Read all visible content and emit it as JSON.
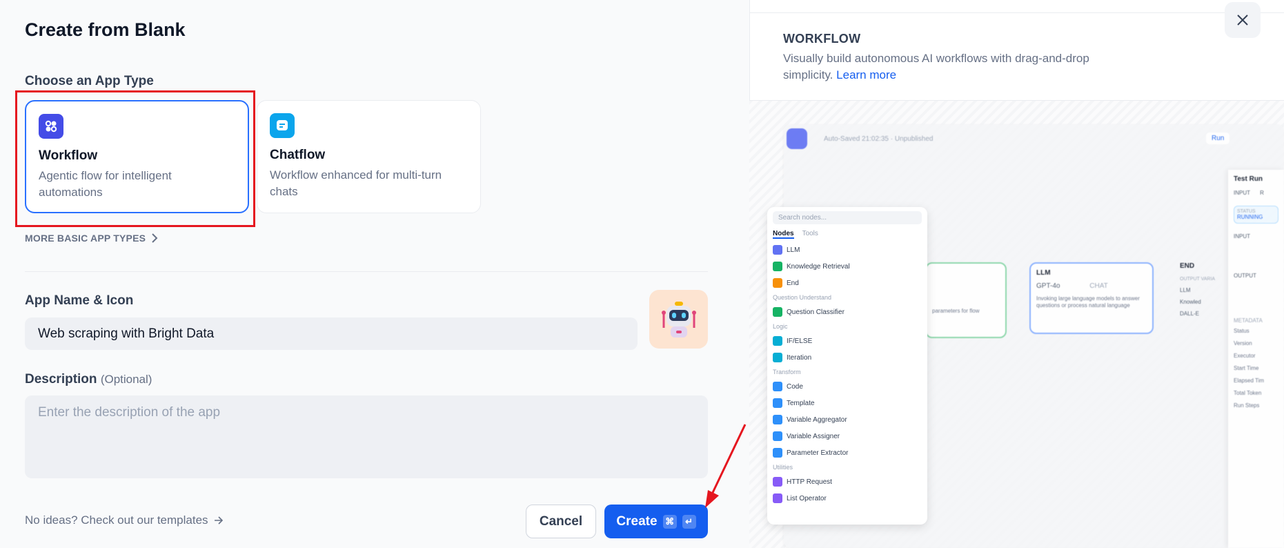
{
  "dialog": {
    "title": "Create from Blank",
    "app_type_label": "Choose an App Type",
    "cards": [
      {
        "name": "Workflow",
        "desc": "Agentic flow for intelligent automations",
        "icon": "workflow-icon",
        "color": "#444ce7",
        "selected": true
      },
      {
        "name": "Chatflow",
        "desc": "Workflow enhanced for multi-turn chats",
        "icon": "chat-icon",
        "color": "#0ba5ec",
        "selected": false
      }
    ],
    "more_types": "MORE BASIC APP TYPES",
    "name_label": "App Name & Icon",
    "name_value": "Web scraping with Bright Data",
    "description_label": "Description",
    "description_optional": "(Optional)",
    "description_placeholder": "Enter the description of the app",
    "templates_link": "No ideas? Check out our templates",
    "cancel": "Cancel",
    "create": "Create",
    "kbd_cmd": "⌘",
    "kbd_enter": "↵"
  },
  "preview": {
    "heading": "WORKFLOW",
    "description": "Visually build autonomous AI workflows with drag-and-drop simplicity.",
    "learn_more": "Learn more",
    "autosaved": "Auto-Saved 21:02:35 · Unpublished",
    "run": "Run",
    "search_placeholder": "Search nodes...",
    "tabs": [
      "Nodes",
      "Tools"
    ],
    "groups": [
      {
        "label": "",
        "items": [
          {
            "name": "LLM",
            "color": "#6172f3"
          },
          {
            "name": "Knowledge Retrieval",
            "color": "#16b364"
          },
          {
            "name": "End",
            "color": "#f79009"
          }
        ]
      },
      {
        "label": "Question Understand",
        "items": [
          {
            "name": "Question Classifier",
            "color": "#16b364"
          }
        ]
      },
      {
        "label": "Logic",
        "items": [
          {
            "name": "IF/ELSE",
            "color": "#06aed4"
          },
          {
            "name": "Iteration",
            "color": "#06aed4"
          }
        ]
      },
      {
        "label": "Transform",
        "items": [
          {
            "name": "Code",
            "color": "#2e90fa"
          },
          {
            "name": "Template",
            "color": "#2e90fa"
          },
          {
            "name": "Variable Aggregator",
            "color": "#2e90fa"
          },
          {
            "name": "Variable Assigner",
            "color": "#2e90fa"
          },
          {
            "name": "Parameter Extractor",
            "color": "#2e90fa"
          }
        ]
      },
      {
        "label": "Utilities",
        "items": [
          {
            "name": "HTTP Request",
            "color": "#875bf7"
          },
          {
            "name": "List Operator",
            "color": "#875bf7"
          }
        ]
      }
    ],
    "llm_node": {
      "title": "LLM",
      "model": "GPT-4o",
      "badge": "CHAT",
      "desc": "Invoking large language models to answer questions or process natural language"
    },
    "end_node": {
      "title": "END",
      "vars_label": "OUTPUT VARIA",
      "items": [
        "LLM",
        "Knowled",
        "DALL-E"
      ]
    },
    "partial_node_desc": "parameters for flow",
    "test_run": {
      "title": "Test Run",
      "tabs": [
        "INPUT",
        "R"
      ],
      "status_label": "STATUS",
      "status_value": "RUNNING",
      "input_label": "INPUT",
      "output_label": "OUTPUT",
      "metadata_label": "METADATA",
      "meta": [
        "Status",
        "Version",
        "Executor",
        "Start Time",
        "Elapsed Tim",
        "Total Token",
        "Run Steps"
      ]
    }
  }
}
